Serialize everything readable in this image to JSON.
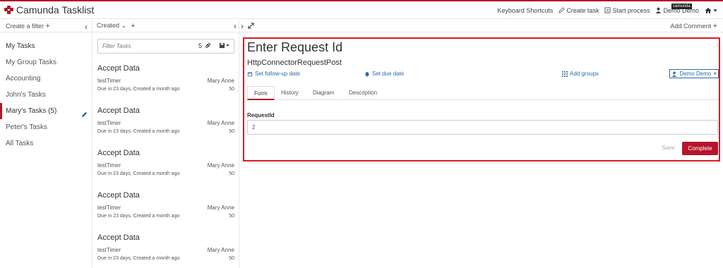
{
  "app": {
    "name": "Camunda Tasklist"
  },
  "header": {
    "keyboard_shortcuts": "Keyboard Shortcuts",
    "create_task": "Create task",
    "start_process": "Start process",
    "user": "Demo Demo",
    "user_badge": "camunda",
    "brand_color": "#b5152b"
  },
  "filters": {
    "create_label": "Create a filter",
    "items": [
      {
        "label": "My Tasks"
      },
      {
        "label": "My Group Tasks"
      },
      {
        "label": "Accounting"
      },
      {
        "label": "John's Tasks"
      },
      {
        "label": "Mary's Tasks",
        "count": "(5)"
      },
      {
        "label": "Peter's Tasks"
      },
      {
        "label": "All Tasks"
      }
    ]
  },
  "tasklist": {
    "sort_label": "Created",
    "search_placeholder": "Filter Tasks",
    "count": "5",
    "tasks": [
      {
        "name": "Accept Data",
        "process": "testTimer",
        "assignee": "Mary Anne",
        "due": "Due in 23 days, Created a month ago",
        "priority": "50"
      },
      {
        "name": "Accept Data",
        "process": "testTimer",
        "assignee": "Mary Anne",
        "due": "Due in 23 days, Created a month ago",
        "priority": "50"
      },
      {
        "name": "Accept Data",
        "process": "testTimer",
        "assignee": "Mary Anne",
        "due": "Due in 23 days, Created a month ago",
        "priority": "50"
      },
      {
        "name": "Accept Data",
        "process": "testTimer",
        "assignee": "Mary Anne",
        "due": "Due in 23 days, Created a month ago",
        "priority": "50"
      },
      {
        "name": "Accept Data",
        "process": "testTimer",
        "assignee": "Mary Anne",
        "due": "Due in 23 days, Created a month ago",
        "priority": "50"
      }
    ]
  },
  "task_detail": {
    "add_comment": "Add Comment",
    "title": "Enter Request Id",
    "process_name": "HttpConnectorRequestPost",
    "follow_up": "Set follow-up date",
    "due_date": "Set due date",
    "add_groups": "Add groups",
    "assignee": "Demo Demo",
    "tabs": [
      "Form",
      "History",
      "Diagram",
      "Description"
    ],
    "field_label": "RequestId",
    "field_value": "2",
    "save_label": "Save",
    "complete_label": "Complete"
  }
}
